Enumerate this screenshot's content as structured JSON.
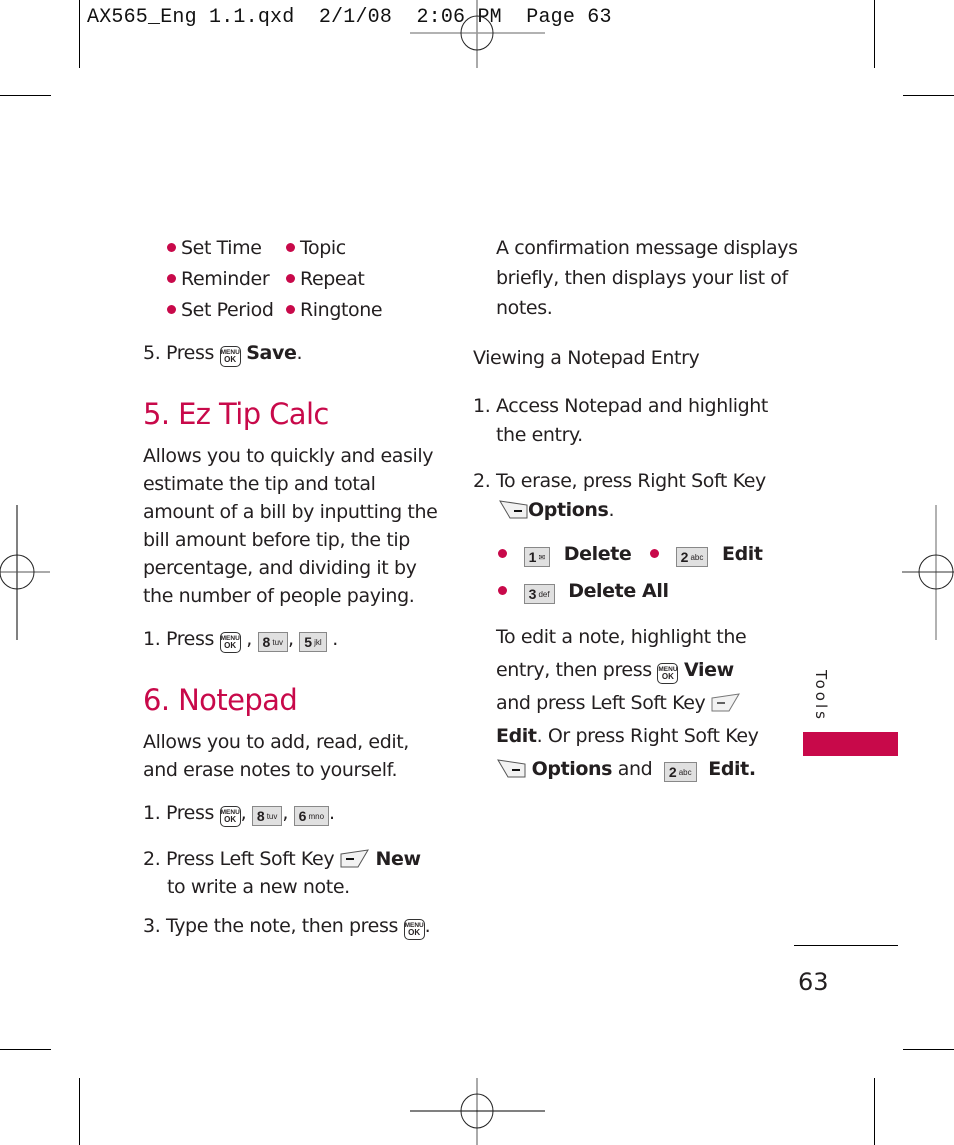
{
  "print_slug": "AX565_Eng 1.1.qxd  2/1/08  2:06 PM  Page 63",
  "left_column": {
    "bullet_list": [
      {
        "label": "Set Time"
      },
      {
        "label": "Topic"
      },
      {
        "label": "Reminder"
      },
      {
        "label": "Repeat"
      },
      {
        "label": "Set Period"
      },
      {
        "label": "Ringtone"
      }
    ],
    "step5": {
      "prefix": "5. Press",
      "key": "MENU OK",
      "action": "Save",
      "suffix": "."
    },
    "ez_tip_calc": {
      "title": "5. Ez Tip Calc",
      "description_lines": [
        "Allows you to quickly and easily",
        "estimate the tip and total",
        "amount of a bill by inputting the",
        "bill amount before tip, the tip",
        "percentage, and dividing it by",
        "the number of people paying."
      ],
      "step1": {
        "prefix": "1. Press",
        "keys": [
          {
            "num": "8",
            "letters": "tuv"
          },
          {
            "num": "5",
            "letters": "jkl"
          }
        ]
      }
    },
    "notepad": {
      "title": "6. Notepad",
      "description_lines": [
        "Allows you to add, read, edit,",
        "and erase notes to yourself."
      ],
      "step1": {
        "prefix": "1. Press",
        "keys": [
          {
            "num": "8",
            "letters": "tuv"
          },
          {
            "num": "6",
            "letters": "mno"
          }
        ]
      },
      "step2": {
        "prefix": "2. Press Left Soft Key",
        "action": "New",
        "line2": "to write a new note."
      },
      "step3": {
        "prefix": "3. Type the note, then press",
        "suffix": "."
      }
    }
  },
  "right_column": {
    "confirmation_lines": [
      "A confirmation message displays",
      "briefly, then displays your list of",
      "notes."
    ],
    "viewing_heading": "Viewing a Notepad Entry",
    "step1_lines": [
      "1. Access Notepad and highlight",
      "the entry."
    ],
    "step2": {
      "line1": "2. To erase, press Right Soft Key",
      "action": "Options",
      "suffix": "."
    },
    "options": [
      {
        "num": "1",
        "letters": "✉",
        "label": "Delete"
      },
      {
        "num": "2",
        "letters": "abc",
        "label": "Edit"
      },
      {
        "num": "3",
        "letters": "def",
        "label": "Delete All"
      }
    ],
    "edit_note": {
      "line1": "To edit a note, highlight the",
      "line2_prefix": "entry, then press",
      "line2_action": "View",
      "line3": "and press Left Soft Key",
      "line4_action": "Edit",
      "line4_rest": ". Or press Right Soft Key",
      "line5_action": "Options",
      "line5_mid": "and",
      "line5_key": {
        "num": "2",
        "letters": "abc"
      },
      "line5_end": "Edit."
    }
  },
  "side_tab": {
    "label": "Tools",
    "color": "#c8094a"
  },
  "page_number": "63",
  "keys": {
    "menu_top": "MENU",
    "menu_bottom": "OK"
  }
}
